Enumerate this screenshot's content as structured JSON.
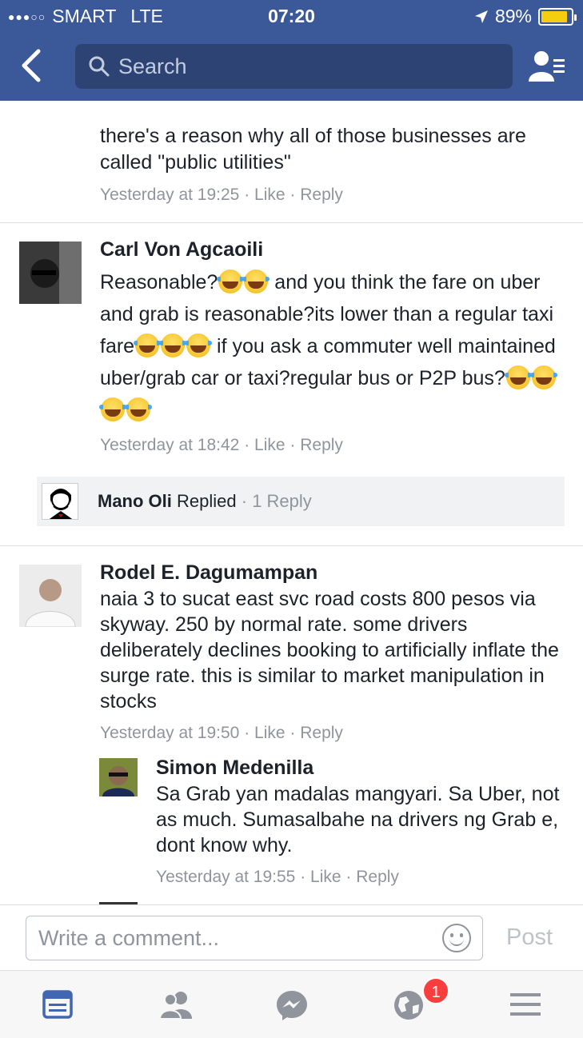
{
  "status_bar": {
    "carrier": "SMART",
    "network": "LTE",
    "time": "07:20",
    "battery_percent": "89%",
    "battery_level": 0.89
  },
  "nav": {
    "search_placeholder": "Search"
  },
  "comments": [
    {
      "author": "",
      "text": "there's a reason why all of those businesses are called \"public utilities\"",
      "time": "Yesterday at 19:25",
      "like": "Like",
      "reply": "Reply"
    },
    {
      "author": "Carl Von Agcaoili",
      "text_parts": [
        "Reasonable?",
        "and you think the fare on uber and grab is reasonable?its lower than a regular taxi fare",
        "if you ask a commuter well maintained uber/grab car or taxi?regular bus or P2P bus?"
      ],
      "time": "Yesterday at 18:42",
      "like": "Like",
      "reply": "Reply",
      "replied_by": "Mano Oli",
      "replied_label": "Replied",
      "reply_count": "1 Reply"
    },
    {
      "author": "Rodel E. Dagumampan",
      "text": "naia 3 to sucat east svc road costs 800 pesos via skyway. 250 by normal rate. some drivers deliberately declines booking to artificially inflate the surge rate. this is similar to market manipulation in stocks",
      "time": "Yesterday at 19:50",
      "like": "Like",
      "reply": "Reply"
    },
    {
      "author": "Simon Medenilla",
      "text": "Sa Grab yan madalas mangyari. Sa Uber, not as much. Sumasalbahe na drivers ng Grab e, dont know why.",
      "time": "Yesterday at 19:55",
      "like": "Like",
      "reply": "Reply"
    }
  ],
  "composer": {
    "placeholder": "Write a comment...",
    "post_label": "Post"
  },
  "tabbar": {
    "notification_count": "1",
    "active_color": "#4267b2",
    "inactive_color": "#90949c"
  },
  "colors": {
    "header": "#3b5998",
    "badge": "#fa3e3e"
  }
}
